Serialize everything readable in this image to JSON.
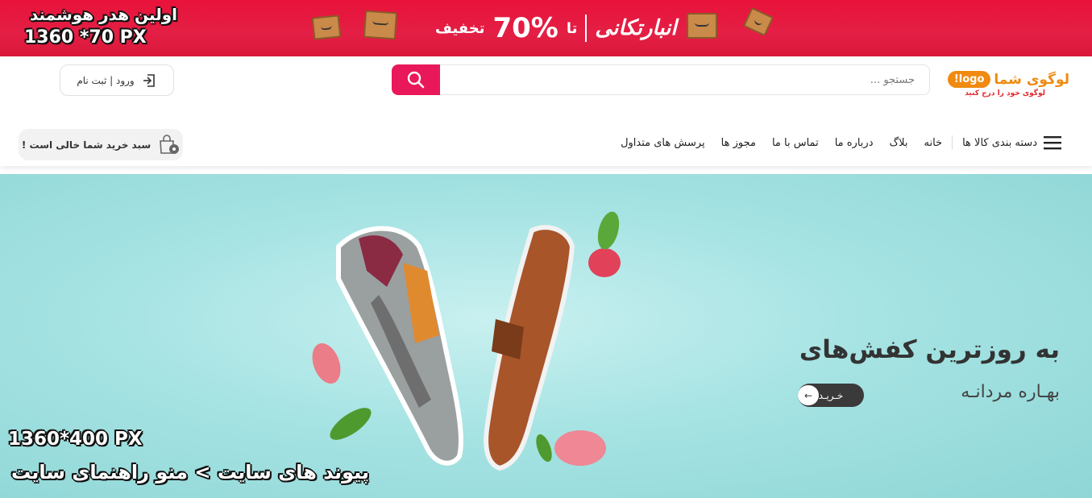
{
  "promo": {
    "title": "اولین هدر هوشمند",
    "dimensions": "1360 *70 PX",
    "discount_word": "تخفیف",
    "percent": "70%",
    "upto": "تا",
    "brand": "انبارتکانی"
  },
  "header": {
    "logo_main": "لوگوی شما",
    "logo_pill": "logo!",
    "logo_sub": "لوگوی خود را درج کنید",
    "search_placeholder": "جستجو ...",
    "login_label": "ورود | ثبت نام",
    "cart_label": "سبد خرید شما خالی است !"
  },
  "nav": {
    "categories_label": "دسته بندی کالا ها",
    "items": [
      "خانه",
      "بلاگ",
      "درباره ما",
      "تماس با ما",
      "مجوز ها",
      "پرسش های متداول"
    ]
  },
  "hero": {
    "title": "به روزترین کفش‌های",
    "subtitle": "بهـاره مردانـه",
    "buy_label": "خـریـد",
    "dimensions": "1360*400 PX",
    "path": "پیوند های سایت > منو راهنمای سایت"
  },
  "colors": {
    "promo_bg": "#e41f45",
    "accent_pink": "#e8185a",
    "logo_orange": "#f08a10",
    "hero_bg": "#a6e3e3"
  }
}
